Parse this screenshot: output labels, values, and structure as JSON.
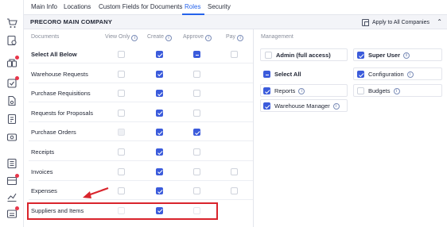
{
  "tabs": [
    {
      "label": "Main Info",
      "active": false
    },
    {
      "label": "Locations",
      "active": false
    },
    {
      "label": "Custom Fields for Documents",
      "active": false
    },
    {
      "label": "Roles",
      "active": true
    },
    {
      "label": "Security",
      "active": false
    }
  ],
  "company": {
    "name": "PRECORO MAIN COMPANY",
    "apply_all_label": "Apply to All Companies"
  },
  "documents": {
    "section_title": "Documents",
    "columns": [
      "View Only",
      "Create",
      "Approve",
      "Pay"
    ],
    "rows": [
      {
        "label": "Select All Below",
        "bold": true,
        "view_only": "unchecked",
        "create": "checked",
        "approve": "partial",
        "pay": "unchecked"
      },
      {
        "label": "Warehouse Requests",
        "view_only": "unchecked",
        "create": "checked",
        "approve": "unchecked",
        "pay": "none"
      },
      {
        "label": "Purchase Requisitions",
        "view_only": "unchecked",
        "create": "checked",
        "approve": "unchecked",
        "pay": "none"
      },
      {
        "label": "Requests for Proposals",
        "view_only": "unchecked",
        "create": "checked",
        "approve": "unchecked",
        "pay": "none"
      },
      {
        "label": "Purchase Orders",
        "view_only": "disabled",
        "create": "checked",
        "approve": "checked",
        "pay": "none"
      },
      {
        "label": "Receipts",
        "view_only": "unchecked",
        "create": "checked",
        "approve": "unchecked",
        "pay": "none"
      },
      {
        "label": "Invoices",
        "view_only": "unchecked",
        "create": "checked",
        "approve": "unchecked",
        "pay": "unchecked"
      },
      {
        "label": "Expenses",
        "view_only": "unchecked",
        "create": "checked",
        "approve": "unchecked",
        "pay": "unchecked"
      },
      {
        "label": "Suppliers and Items",
        "view_only": "faint",
        "create": "checked",
        "approve": "faint",
        "pay": "none",
        "highlighted": true
      }
    ]
  },
  "management": {
    "section_title": "Management",
    "items": [
      {
        "label": "Admin (full access)",
        "bold": true,
        "state": "unchecked",
        "info": false
      },
      {
        "label": "Super User",
        "bold": true,
        "state": "checked",
        "info": true
      },
      {
        "label": "Select All",
        "bold": true,
        "state": "partial",
        "info": false
      },
      {
        "label": "Configuration",
        "bold": false,
        "state": "checked",
        "info": true
      },
      {
        "label": "Reports",
        "bold": false,
        "state": "checked",
        "info": true
      },
      {
        "label": "Budgets",
        "bold": false,
        "state": "unchecked",
        "info": true
      },
      {
        "label": "Warehouse Manager",
        "bold": false,
        "state": "checked",
        "info": true
      }
    ]
  },
  "sidebar_icons": [
    "cart-icon",
    "requisition-icon",
    "approval-icon",
    "checklist-icon",
    "document-icon",
    "invoice-icon",
    "expense-icon",
    "budget-icon",
    "inventory-icon",
    "analytics-icon",
    "warehouse-icon"
  ],
  "colors": {
    "accent": "#2563eb",
    "checkbox": "#3b5bdb",
    "highlight": "#d9242c",
    "badge": "#e8364b"
  }
}
